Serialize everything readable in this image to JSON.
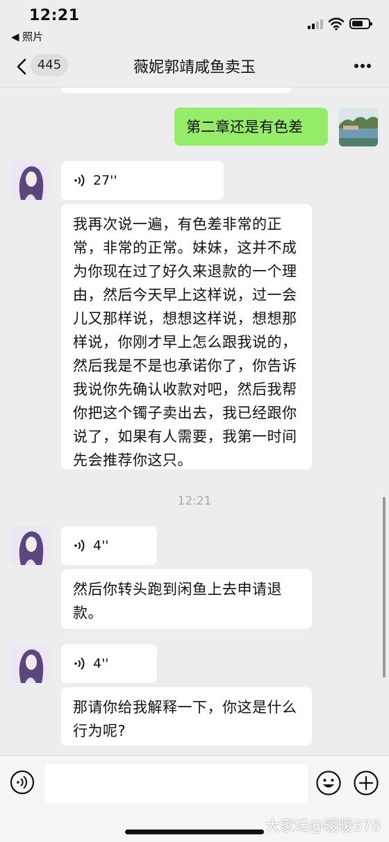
{
  "status": {
    "time": "12:21",
    "back_app": "◀ 照片"
  },
  "nav": {
    "unread_count": "445",
    "title": "薇妮郭靖咸鱼卖玉"
  },
  "messages": {
    "sent_1": "第二章还是有色差",
    "voice_1": "27''",
    "text_1": "我再次说一遍，有色差非常的正常，非常的正常。妹妹，这并不成为你现在过了好久来退款的一个理由，然后今天早上这样说，过一会儿又那样说，想想这样说，想想那样说，你刚才早上怎么跟我说的，然后我是不是也承诺你了，你告诉我说你先确认收款对吧，然后我帮你把这个镯子卖出去，我已经跟你说了，如果有人需要，我第一时间先会推荐你这只。",
    "timestamp": "12:21",
    "voice_2": "4''",
    "text_2": "然后你转头跑到闲鱼上去申请退款。",
    "voice_3": "4''",
    "text_3": "那请你给我解释一下，你这是什么行为呢?"
  },
  "watermark": "大家坛@暖暖678",
  "colors": {
    "sent_bubble": "#95ec69",
    "background": "#ededed",
    "received_bubble": "#ffffff"
  }
}
